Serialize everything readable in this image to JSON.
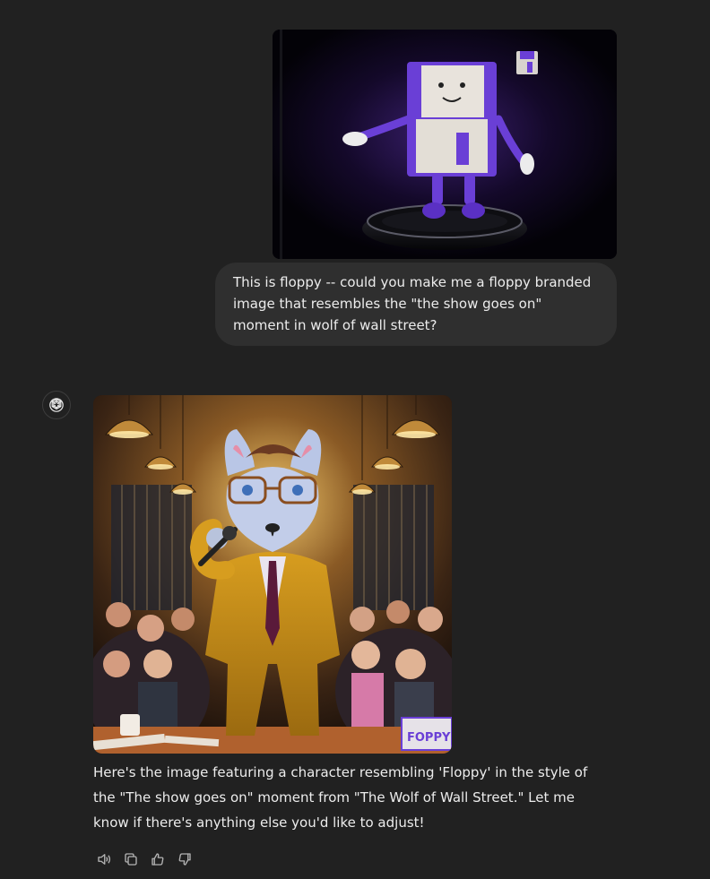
{
  "conversation": {
    "user_message": {
      "image_alt": "Floppy mascot: a purple and white floppy-disk character standing on a pedestal",
      "text": "This is floppy -- could you make me a floppy branded image that resembles the \"the show goes on\" moment in wolf of wall street?"
    },
    "assistant_message": {
      "image_alt": "Fox character in a mustard suit with glasses holding a microphone in front of a cheering crowd",
      "image_box_text": "FOPPY",
      "text": "Here's the image featuring a character resembling 'Floppy' in the style of the \"The show goes on\" moment from \"The Wolf of Wall Street.\" Let me know if there's anything else you'd like to adjust!"
    }
  },
  "actions": [
    {
      "name": "read-aloud",
      "icon": "speaker-icon"
    },
    {
      "name": "copy",
      "icon": "copy-icon"
    },
    {
      "name": "good-response",
      "icon": "thumbs-up-icon"
    },
    {
      "name": "bad-response",
      "icon": "thumbs-down-icon"
    }
  ],
  "colors": {
    "background": "#212121",
    "user_bubble": "#2f2f2f",
    "text": "#ececec",
    "icon": "#b4b4b4",
    "floppy_purple": "#6a3fd6"
  }
}
